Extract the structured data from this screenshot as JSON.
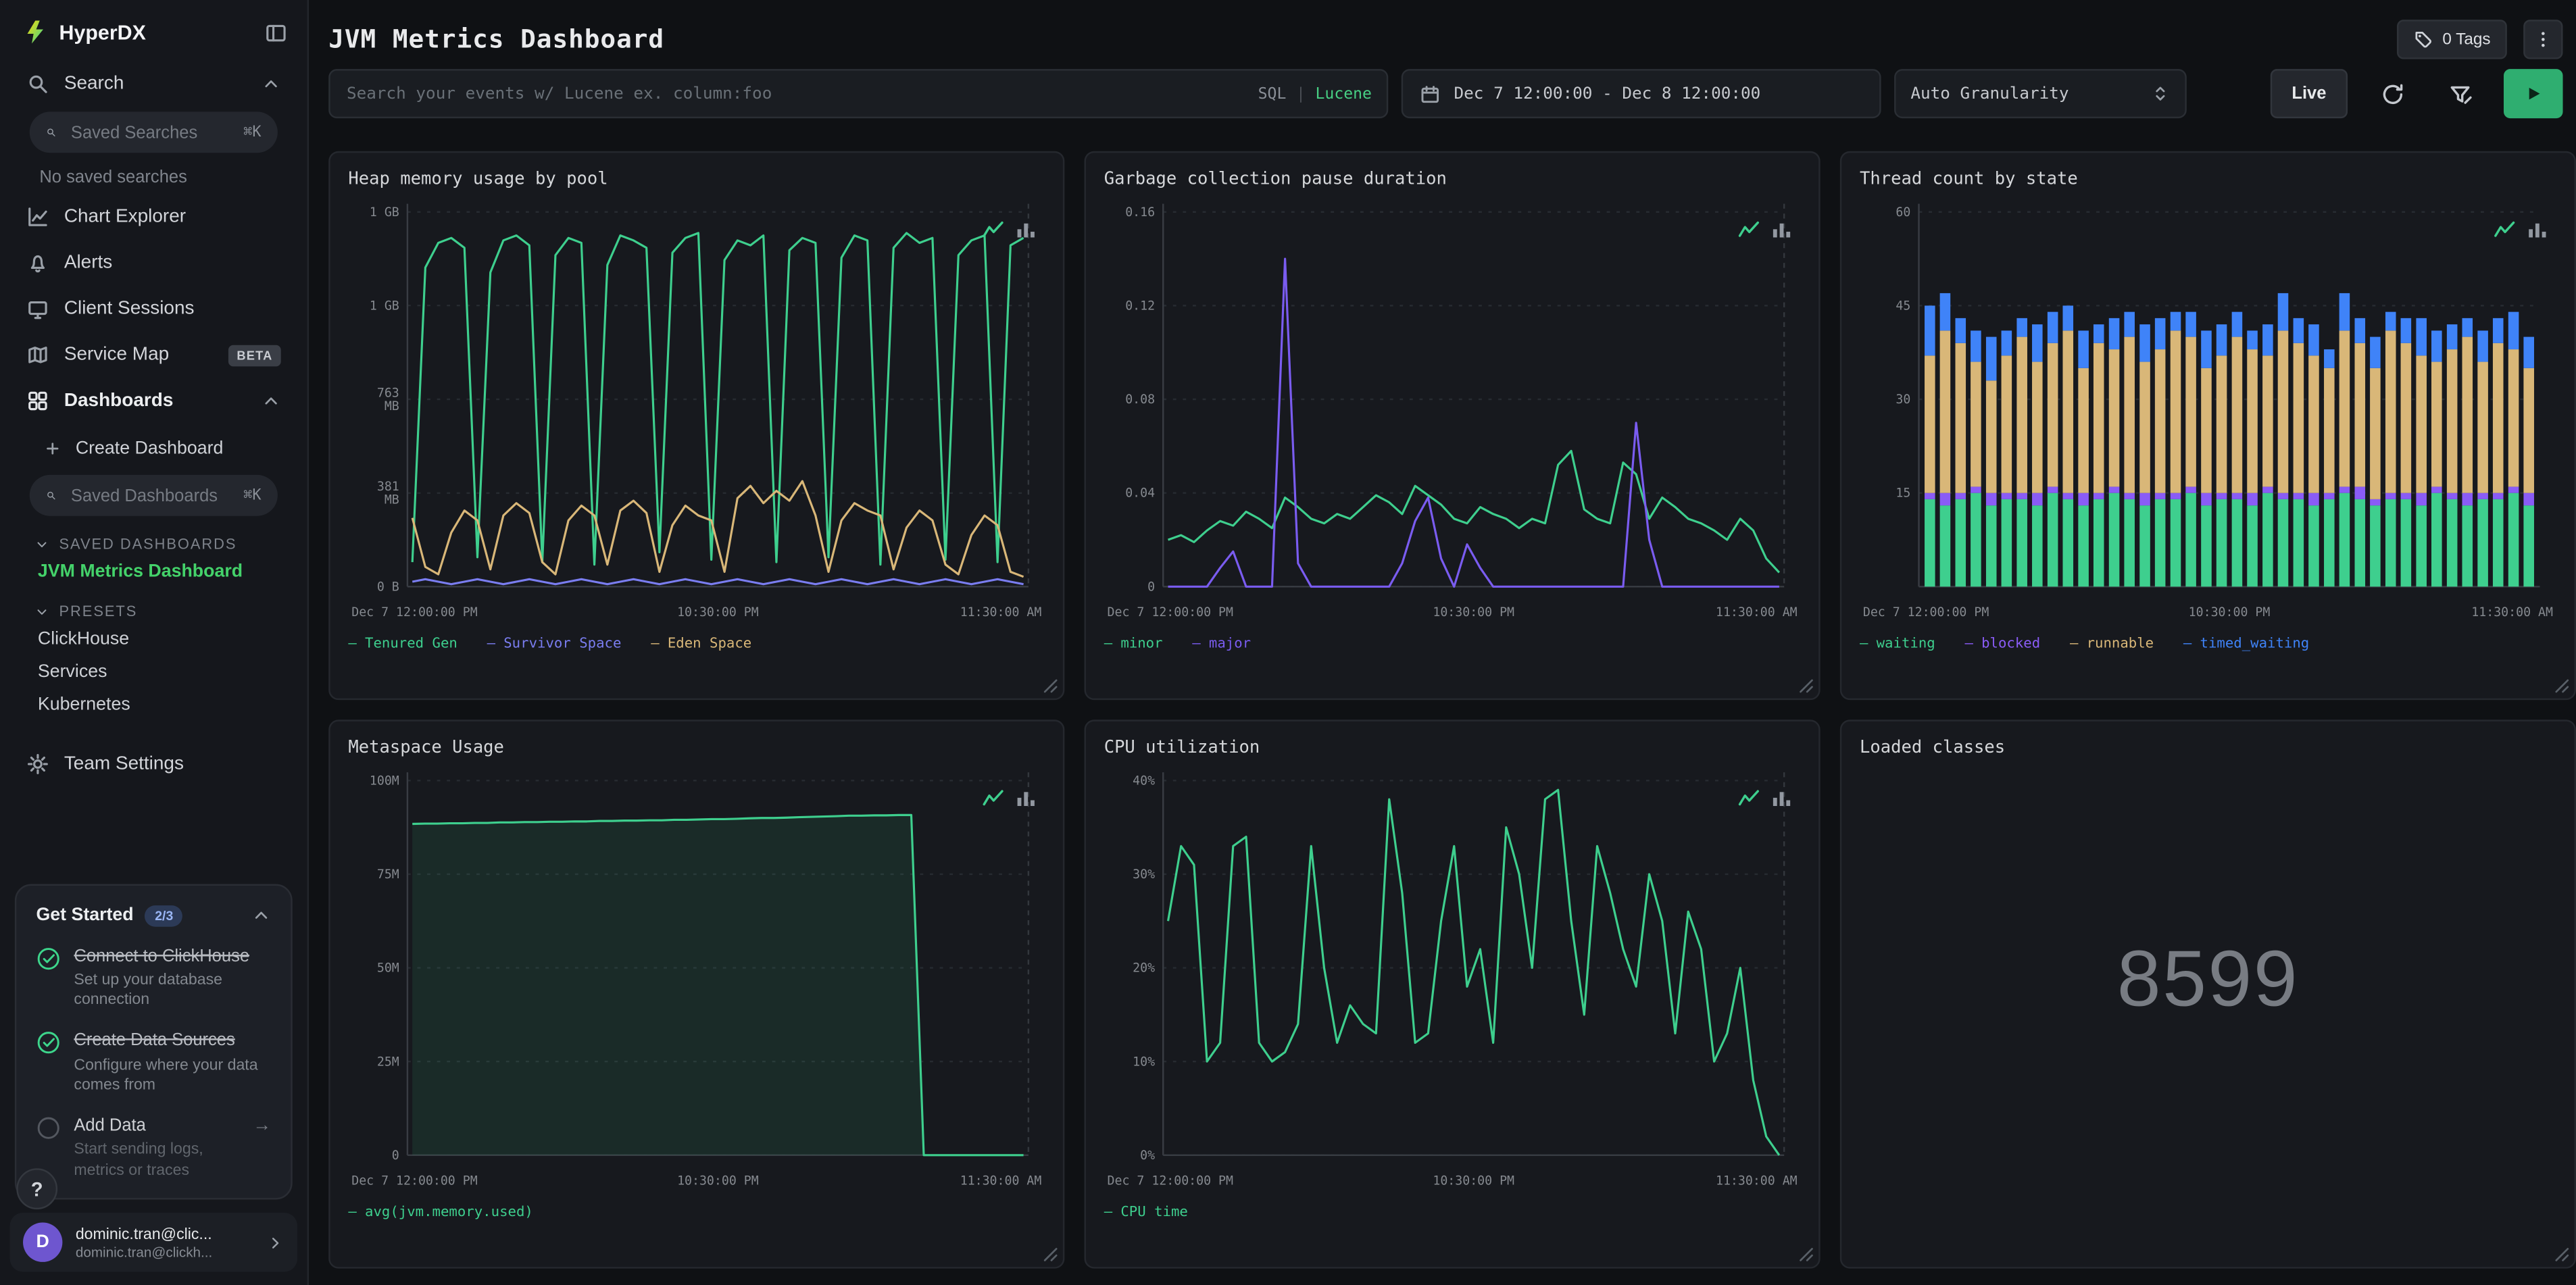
{
  "app": {
    "name": "HyperDX"
  },
  "sidebar": {
    "nav": {
      "search": "Search",
      "chart_explorer": "Chart Explorer",
      "alerts": "Alerts",
      "client_sessions": "Client Sessions",
      "service_map": "Service Map",
      "service_map_badge": "BETA",
      "dashboards": "Dashboards",
      "create_dashboard": "Create Dashboard",
      "team_settings": "Team Settings"
    },
    "saved_searches_placeholder": "Saved Searches",
    "saved_searches_kbd": "⌘K",
    "no_saved_searches": "No saved searches",
    "saved_dashboards_placeholder": "Saved Dashboards",
    "saved_dashboards_kbd": "⌘K",
    "sections": {
      "saved_dashboards_label": "SAVED DASHBOARDS",
      "active_dashboard": "JVM Metrics Dashboard",
      "presets_label": "PRESETS",
      "presets": [
        "ClickHouse",
        "Services",
        "Kubernetes"
      ]
    },
    "get_started": {
      "title": "Get Started",
      "badge": "2/3",
      "steps": [
        {
          "title": "Connect to ClickHouse",
          "subtitle": "Set up your database connection"
        },
        {
          "title": "Create Data Sources",
          "subtitle": "Configure where your data comes from"
        },
        {
          "title": "Add Data",
          "subtitle": "Start sending logs, metrics or traces"
        }
      ]
    },
    "help": "?",
    "user": {
      "initial": "D",
      "name": "dominic.tran@clic...",
      "email": "dominic.tran@clickh..."
    }
  },
  "header": {
    "title": "JVM Metrics Dashboard",
    "tags_button": "0 Tags"
  },
  "toolbar": {
    "search_placeholder": "Search your events w/ Lucene ex. column:foo",
    "lang_sql": "SQL",
    "lang_sep": "|",
    "lang_lucene": "Lucene",
    "time_range": "Dec 7 12:00:00 - Dec 8 12:00:00",
    "granularity": "Auto Granularity",
    "live": "Live"
  },
  "colors": {
    "green": "#3ecf8e",
    "yellow": "#d9b778",
    "purple": "#7a5cf0",
    "blue": "#3f83f8",
    "survivor": "#7a7df0",
    "accent_green": "#44d26a"
  },
  "panels": [
    {
      "title": "Heap memory usage by pool",
      "chart_data": {
        "type": "line",
        "xtick_labels": [
          "Dec 7 12:00:00 PM",
          "10:30:00 PM",
          "11:30:00 AM"
        ],
        "ylim": [
          0,
          1.526
        ],
        "yticks": [
          {
            "v": 1.526,
            "label": "1 GB"
          },
          {
            "v": 1.145,
            "label": "1 GB"
          },
          {
            "v": 0.763,
            "label": "763\nMB"
          },
          {
            "v": 0.381,
            "label": "381\nMB"
          },
          {
            "v": 0,
            "label": "0 B"
          }
        ],
        "unit": "GB",
        "series": [
          {
            "name": "Tenured Gen",
            "color": "#3ecf8e",
            "values": [
              0.1,
              1.3,
              1.4,
              1.42,
              1.38,
              0.12,
              1.28,
              1.41,
              1.43,
              1.39,
              0.1,
              1.35,
              1.42,
              1.4,
              0.09,
              1.31,
              1.43,
              1.41,
              1.38,
              0.14,
              1.36,
              1.42,
              1.44,
              0.11,
              1.33,
              1.41,
              1.39,
              1.43,
              0.1,
              1.37,
              1.42,
              1.4,
              0.12,
              1.34,
              1.43,
              1.41,
              0.09,
              1.38,
              1.44,
              1.4,
              1.42,
              0.11,
              1.35,
              1.41,
              1.43,
              0.1,
              1.39,
              1.42
            ]
          },
          {
            "name": "Survivor Space",
            "color": "#7a7df0",
            "values": [
              0.02,
              0.03,
              0.02,
              0.01,
              0.02,
              0.03,
              0.02,
              0.01,
              0.02,
              0.03,
              0.02,
              0.01,
              0.02,
              0.03,
              0.02,
              0.01,
              0.02,
              0.03,
              0.02,
              0.01,
              0.02,
              0.03,
              0.02,
              0.01,
              0.02,
              0.03,
              0.02,
              0.01,
              0.02,
              0.03,
              0.02,
              0.01,
              0.02,
              0.03,
              0.02,
              0.01,
              0.02,
              0.03,
              0.02,
              0.01,
              0.02,
              0.03,
              0.02,
              0.01,
              0.02,
              0.03,
              0.02,
              0.01
            ]
          },
          {
            "name": "Eden Space",
            "color": "#d9b778",
            "values": [
              0.28,
              0.08,
              0.05,
              0.22,
              0.31,
              0.27,
              0.07,
              0.29,
              0.34,
              0.3,
              0.1,
              0.05,
              0.27,
              0.33,
              0.29,
              0.09,
              0.31,
              0.35,
              0.3,
              0.06,
              0.25,
              0.33,
              0.29,
              0.27,
              0.06,
              0.36,
              0.41,
              0.34,
              0.39,
              0.35,
              0.43,
              0.29,
              0.06,
              0.27,
              0.34,
              0.31,
              0.29,
              0.07,
              0.24,
              0.31,
              0.27,
              0.09,
              0.05,
              0.21,
              0.29,
              0.25,
              0.06,
              0.04
            ]
          }
        ]
      }
    },
    {
      "title": "Garbage collection pause duration",
      "chart_data": {
        "type": "line",
        "xtick_labels": [
          "Dec 7 12:00:00 PM",
          "10:30:00 PM",
          "11:30:00 AM"
        ],
        "ylim": [
          0,
          0.16
        ],
        "yticks": [
          {
            "v": 0.16,
            "label": "0.16"
          },
          {
            "v": 0.12,
            "label": "0.12"
          },
          {
            "v": 0.08,
            "label": "0.08"
          },
          {
            "v": 0.04,
            "label": "0.04"
          },
          {
            "v": 0,
            "label": "0"
          }
        ],
        "series": [
          {
            "name": "minor",
            "color": "#3ecf8e",
            "values": [
              0.02,
              0.022,
              0.019,
              0.024,
              0.028,
              0.026,
              0.032,
              0.029,
              0.025,
              0.038,
              0.034,
              0.029,
              0.027,
              0.031,
              0.029,
              0.034,
              0.039,
              0.036,
              0.031,
              0.043,
              0.039,
              0.035,
              0.029,
              0.027,
              0.034,
              0.031,
              0.029,
              0.025,
              0.029,
              0.027,
              0.052,
              0.058,
              0.033,
              0.029,
              0.027,
              0.053,
              0.048,
              0.029,
              0.038,
              0.034,
              0.029,
              0.027,
              0.024,
              0.02,
              0.029,
              0.024,
              0.012,
              0.006
            ]
          },
          {
            "name": "major",
            "color": "#7a5cf0",
            "values": [
              0,
              0,
              0,
              0,
              0.008,
              0.015,
              0,
              0,
              0,
              0.14,
              0.01,
              0,
              0,
              0,
              0,
              0,
              0,
              0,
              0.01,
              0.028,
              0.038,
              0.012,
              0,
              0.018,
              0.008,
              0,
              0,
              0,
              0,
              0,
              0,
              0,
              0,
              0,
              0,
              0,
              0.07,
              0.02,
              0,
              0,
              0,
              0,
              0,
              0,
              0,
              0,
              0,
              0
            ]
          }
        ]
      }
    },
    {
      "title": "Thread count by state",
      "chart_data": {
        "type": "stacked_bar",
        "xtick_labels": [
          "Dec 7 12:00:00 PM",
          "10:30:00 PM",
          "11:30:00 AM"
        ],
        "ylim": [
          0,
          60
        ],
        "yticks": [
          {
            "v": 60,
            "label": "60"
          },
          {
            "v": 45,
            "label": "45"
          },
          {
            "v": 30,
            "label": "30"
          },
          {
            "v": 15,
            "label": "15"
          }
        ],
        "series": [
          {
            "name": "waiting",
            "color": "#3ecf8e",
            "values": [
              14,
              13,
              14,
              15,
              13,
              14,
              14,
              13,
              15,
              14,
              13,
              14,
              15,
              14,
              13,
              14,
              14,
              15,
              13,
              14,
              14,
              13,
              15,
              14,
              14,
              13,
              14,
              15,
              14,
              13,
              14,
              14,
              13,
              15,
              14,
              13,
              14,
              14,
              15,
              13
            ]
          },
          {
            "name": "blocked",
            "color": "#8a5cf6",
            "values": [
              1,
              2,
              1,
              1,
              2,
              1,
              1,
              2,
              1,
              1,
              2,
              1,
              1,
              1,
              2,
              1,
              1,
              1,
              2,
              1,
              1,
              2,
              1,
              1,
              1,
              2,
              1,
              1,
              2,
              1,
              1,
              1,
              2,
              1,
              1,
              2,
              1,
              1,
              1,
              2
            ]
          },
          {
            "name": "runnable",
            "color": "#d9b778",
            "values": [
              22,
              26,
              24,
              20,
              18,
              22,
              25,
              21,
              23,
              26,
              20,
              24,
              22,
              25,
              21,
              23,
              26,
              24,
              20,
              22,
              25,
              23,
              21,
              26,
              24,
              22,
              20,
              25,
              23,
              21,
              26,
              24,
              22,
              20,
              23,
              25,
              21,
              24,
              22,
              20
            ]
          },
          {
            "name": "timed_waiting",
            "color": "#3f83f8",
            "values": [
              8,
              6,
              4,
              5,
              7,
              4,
              3,
              6,
              5,
              4,
              6,
              3,
              5,
              4,
              6,
              5,
              3,
              4,
              6,
              5,
              4,
              3,
              5,
              6,
              4,
              5,
              3,
              6,
              4,
              5,
              3,
              4,
              6,
              5,
              4,
              3,
              5,
              4,
              6,
              5
            ]
          }
        ]
      }
    },
    {
      "title": "Metaspace Usage",
      "chart_data": {
        "type": "line",
        "xtick_labels": [
          "Dec 7 12:00:00 PM",
          "10:30:00 PM",
          "11:30:00 AM"
        ],
        "ylim": [
          0,
          100
        ],
        "yticks": [
          {
            "v": 100,
            "label": "100M"
          },
          {
            "v": 75,
            "label": "75M"
          },
          {
            "v": 50,
            "label": "50M"
          },
          {
            "v": 25,
            "label": "25M"
          },
          {
            "v": 0,
            "label": "0"
          }
        ],
        "series": [
          {
            "name": "avg(jvm.memory.used)",
            "color": "#3ecf8e",
            "fill": true,
            "values": [
              88.4,
              88.5,
              88.5,
              88.6,
              88.6,
              88.7,
              88.7,
              88.8,
              88.8,
              88.9,
              88.9,
              89.0,
              89.0,
              89.1,
              89.1,
              89.2,
              89.2,
              89.3,
              89.3,
              89.4,
              89.4,
              89.5,
              89.5,
              89.6,
              89.7,
              89.7,
              89.8,
              89.9,
              90.0,
              90.0,
              90.1,
              90.2,
              90.3,
              90.4,
              90.5,
              90.6,
              90.6,
              90.7,
              90.7,
              90.8,
              90.8,
              0,
              0,
              0,
              0,
              0,
              0,
              0,
              0,
              0
            ]
          }
        ]
      }
    },
    {
      "title": "CPU utilization",
      "chart_data": {
        "type": "line",
        "xtick_labels": [
          "Dec 7 12:00:00 PM",
          "10:30:00 PM",
          "11:30:00 AM"
        ],
        "ylim": [
          0,
          40
        ],
        "yticks": [
          {
            "v": 40,
            "label": "40%"
          },
          {
            "v": 30,
            "label": "30%"
          },
          {
            "v": 20,
            "label": "20%"
          },
          {
            "v": 10,
            "label": "10%"
          },
          {
            "v": 0,
            "label": "0%"
          }
        ],
        "series": [
          {
            "name": "CPU time",
            "color": "#3ecf8e",
            "values": [
              25,
              33,
              31,
              10,
              12,
              33,
              34,
              12,
              10,
              11,
              14,
              33,
              20,
              12,
              16,
              14,
              13,
              38,
              28,
              12,
              13,
              25,
              33,
              18,
              22,
              12,
              35,
              30,
              20,
              38,
              39,
              25,
              15,
              33,
              28,
              22,
              18,
              30,
              25,
              13,
              26,
              22,
              10,
              13,
              20,
              8,
              2,
              0
            ]
          }
        ]
      }
    },
    {
      "title": "Loaded classes",
      "chart_data": {
        "type": "big_number",
        "value": "8599"
      }
    }
  ]
}
